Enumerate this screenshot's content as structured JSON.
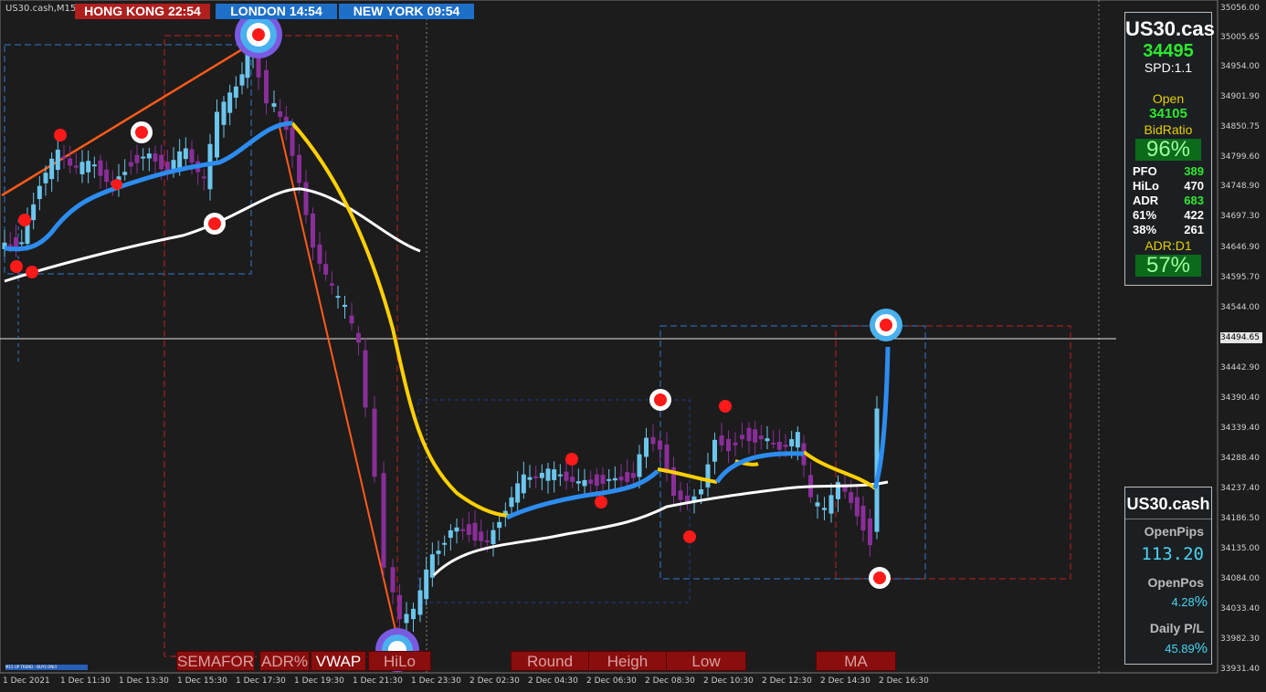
{
  "chart_title": "US30.cash,M15",
  "sessions": [
    {
      "city": "HONG KONG",
      "time": "22:54",
      "color": "#b01e1e"
    },
    {
      "city": "LONDON",
      "time": "14:54",
      "color": "#1e6fc8"
    },
    {
      "city": "NEW YORK",
      "time": "09:54",
      "color": "#1e6fc8"
    }
  ],
  "price_axis": [
    "35056.00",
    "35005.65",
    "34954.00",
    "34901.90",
    "34850.75",
    "34799.60",
    "34748.90",
    "34697.30",
    "34646.90",
    "34595.70",
    "34544.00",
    "34442.90",
    "34390.40",
    "34339.40",
    "34288.40",
    "34237.40",
    "34186.50",
    "34135.00",
    "34084.00",
    "34033.40",
    "33982.30",
    "33931.40"
  ],
  "current_price": "34494.65",
  "time_axis": [
    "1 Dec 2021",
    "1 Dec 11:30",
    "1 Dec 13:30",
    "1 Dec 15:30",
    "1 Dec 17:30",
    "1 Dec 19:30",
    "1 Dec 21:30",
    "1 Dec 23:30",
    "2 Dec 02:30",
    "2 Dec 04:30",
    "2 Dec 06:30",
    "2 Dec 08:30",
    "2 Dec 10:30",
    "2 Dec 12:30",
    "2 Dec 14:30",
    "2 Dec 16:30"
  ],
  "info_panel": {
    "symbol": "US30.cas",
    "price": "34495",
    "spread": "SPD:1.1",
    "open_label": "Open",
    "open_value": "34105",
    "bid_ratio_label": "BidRatio",
    "bid_ratio_value": "96%",
    "stats": [
      {
        "label": "PFO",
        "value": "389",
        "color": "#2ee82e"
      },
      {
        "label": "HiLo",
        "value": "470",
        "color": "#ffffff"
      },
      {
        "label": "ADR",
        "value": "683",
        "color": "#2ee82e"
      },
      {
        "label": "61%",
        "value": "422",
        "color": "#ffffff"
      },
      {
        "label": "38%",
        "value": "261",
        "color": "#ffffff"
      }
    ],
    "adr_d1_label": "ADR:D1",
    "adr_d1_value": "57%"
  },
  "pos_panel": {
    "symbol": "US30.cash",
    "open_pips_label": "OpenPips",
    "open_pips_value": "113.20",
    "open_pos_label": "OpenPos",
    "open_pos_value": "4.28",
    "daily_pl_label": "Daily P/L",
    "daily_pl_value": "45.89",
    "pct_sign": "%"
  },
  "buttons": [
    {
      "label": "SEMAFOR",
      "active": false
    },
    {
      "label": "ADR%",
      "active": false
    },
    {
      "label": "VWAP",
      "active": true
    },
    {
      "label": "HiLo",
      "active": false
    },
    {
      "label": "Round",
      "active": false
    },
    {
      "label": "Heigh",
      "active": false
    },
    {
      "label": "Low",
      "active": false
    },
    {
      "label": "MA",
      "active": false
    }
  ],
  "mini_note": "M15 UP TREND - BUYS ONLY",
  "colors": {
    "bull": "#6bc6ee",
    "bear": "#8a2e9a",
    "ma_fast": "#2d8cf0",
    "ma_slow": "#ffffff",
    "ma_mid": "#ffd000",
    "semafor": "#ff1a1a",
    "trend_line": "#ff5a1a"
  }
}
